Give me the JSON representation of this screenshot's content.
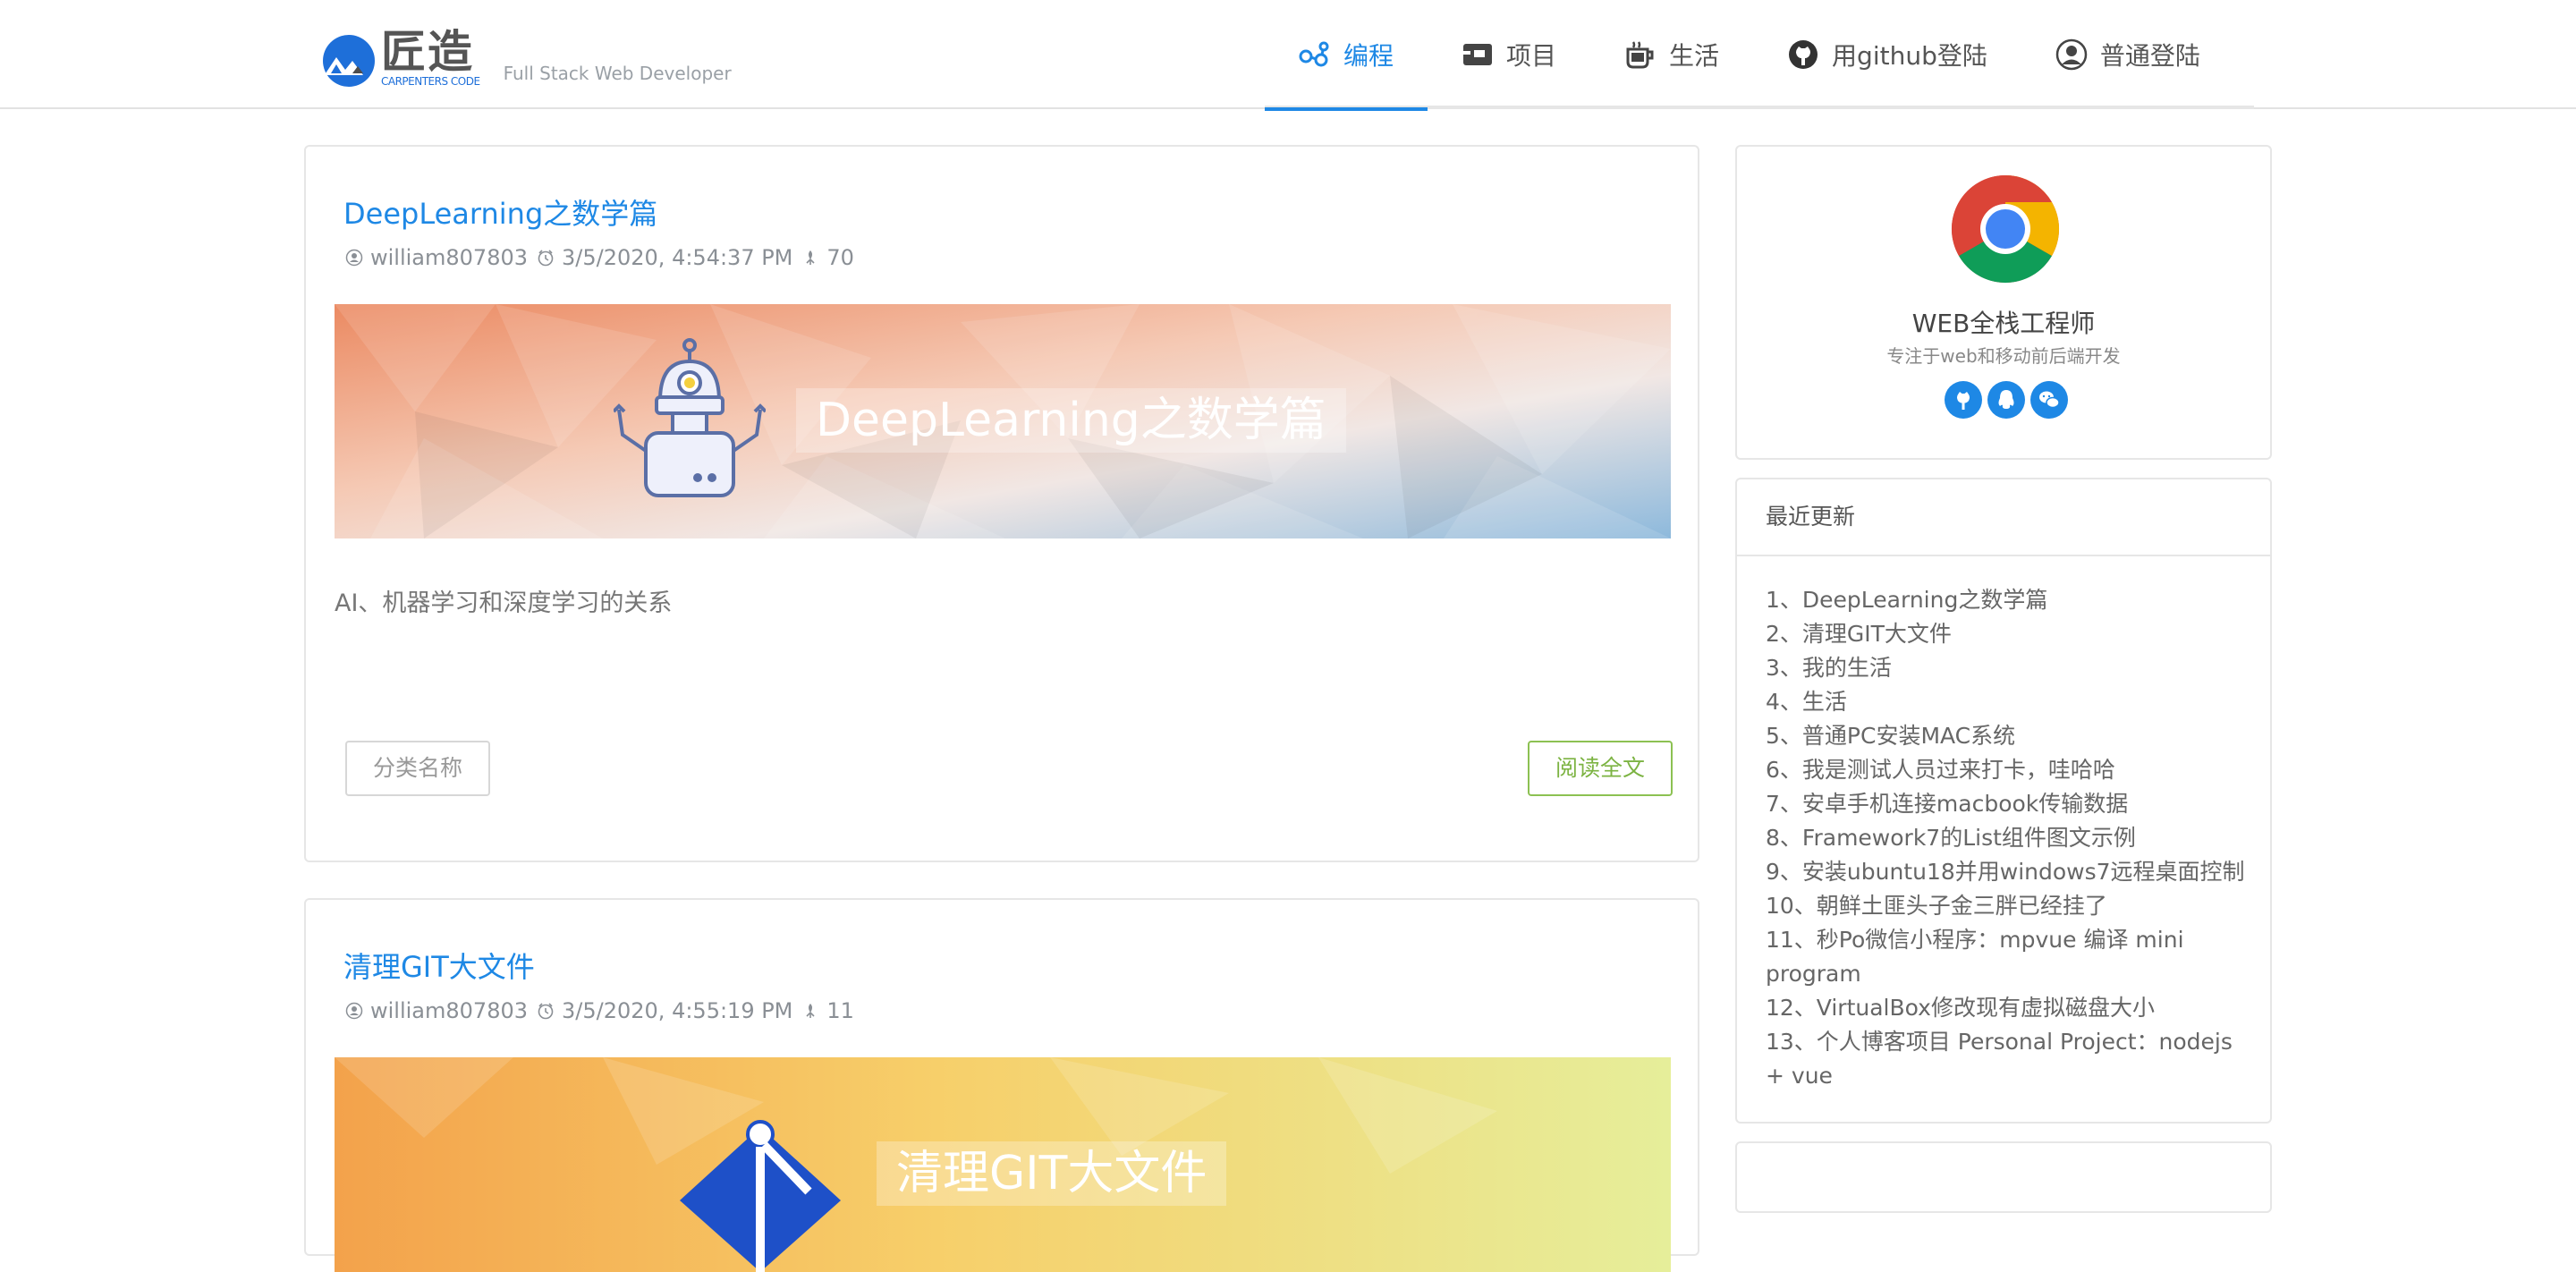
{
  "header": {
    "logo_cn": "匠造",
    "logo_en": "CARPENTERS CODE",
    "tagline": "Full Stack Web Developer",
    "nav": [
      {
        "label": "编程",
        "icon": "graph-nodes-icon",
        "active": true
      },
      {
        "label": "项目",
        "icon": "project-toolbox-icon",
        "active": false
      },
      {
        "label": "生活",
        "icon": "coffee-cup-icon",
        "active": false
      },
      {
        "label": "用github登陆",
        "icon": "github-icon",
        "active": false
      },
      {
        "label": "普通登陆",
        "icon": "user-circle-icon",
        "active": false
      }
    ]
  },
  "posts": [
    {
      "title": "DeepLearning之数学篇",
      "author": "william807803",
      "date": "3/5/2020, 4:54:37 PM",
      "views": "70",
      "banner_title": "DeepLearning之数学篇",
      "summary": "AI、机器学习和深度学习的关系",
      "category_label": "分类名称",
      "read_label": "阅读全文"
    },
    {
      "title": "清理GIT大文件",
      "author": "william807803",
      "date": "3/5/2020, 4:55:19 PM",
      "views": "11",
      "banner_title": "清理GIT大文件"
    }
  ],
  "profile": {
    "name": "WEB全栈工程师",
    "description": "专注于web和移动前后端开发",
    "socials": [
      "github-icon",
      "qq-penguin-icon",
      "wechat-icon"
    ]
  },
  "recent": {
    "heading": "最近更新",
    "items": [
      "1、DeepLearning之数学篇",
      "2、清理GIT大文件",
      "3、我的生活",
      "4、生活",
      "5、普通PC安装MAC系统",
      "6、我是测试人员过来打卡，哇哈哈",
      "7、安卓手机连接macbook传输数据",
      "8、Framework7的List组件图文示例",
      "9、安装ubuntu18并用windows7远程桌面控制",
      "10、朝鲜土匪头子金三胖已经挂了",
      "11、秒Po微信小程序：mpvue 编译 mini program",
      "12、VirtualBox修改现有虚拟磁盘大小",
      "13、个人博客项目 Personal Project：nodejs + vue"
    ]
  },
  "colors": {
    "accent": "#1e88e5",
    "read_button": "#8cc152",
    "text_muted": "#8a8f95"
  }
}
